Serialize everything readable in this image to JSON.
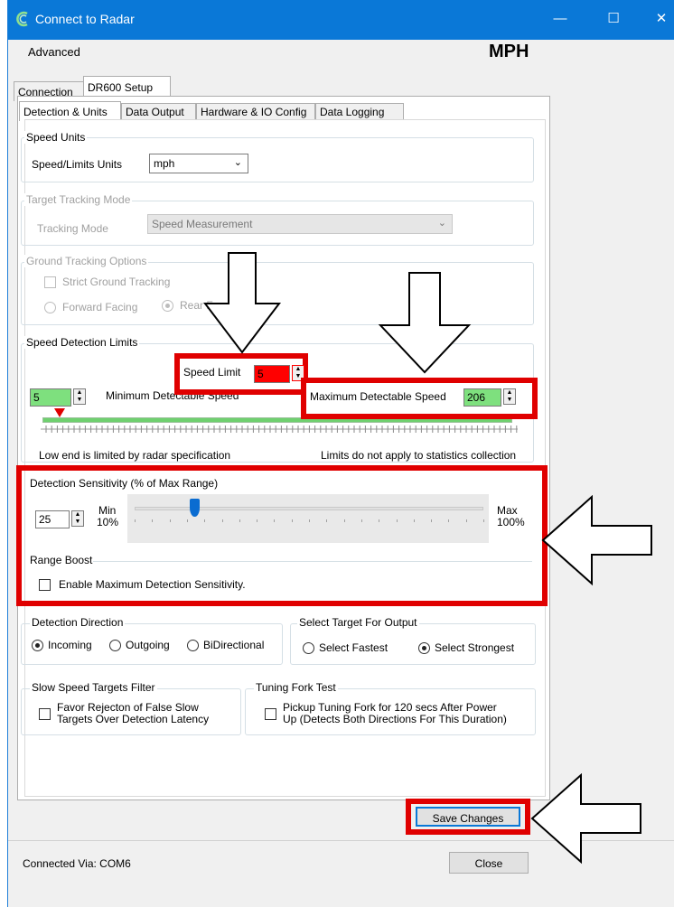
{
  "window": {
    "title": "Connect to Radar",
    "minimize_glyph": "—",
    "maximize_glyph": "☐",
    "close_glyph": "✕"
  },
  "menu": {
    "advanced": "Advanced"
  },
  "units_badge": "MPH",
  "outer_tabs": [
    "Connection",
    "DR600 Setup"
  ],
  "inner_tabs": [
    "Detection & Units",
    "Data Output",
    "Hardware & IO Config",
    "Data Logging"
  ],
  "speed_units": {
    "legend": "Speed Units",
    "label": "Speed/Limits Units",
    "value": "mph"
  },
  "target_tracking": {
    "legend": "Target Tracking Mode",
    "label": "Tracking Mode",
    "value": "Speed Measurement"
  },
  "ground_tracking": {
    "legend": "Ground Tracking Options",
    "strict": "Strict Ground Tracking",
    "forward": "Forward Facing",
    "rear": "Rear F"
  },
  "speed_limits": {
    "legend": "Speed Detection Limits",
    "speed_limit_label": "Speed Limit",
    "speed_limit_value": "5",
    "min_value": "5",
    "min_label": "Minimum Detectable Speed",
    "max_label": "Maximum Detectable Speed",
    "max_value": "206",
    "note_left": "Low end is limited by radar specification",
    "note_right": "Limits do not apply to statistics collection"
  },
  "sensitivity": {
    "legend": "Detection Sensitivity (% of Max Range)",
    "value": "25",
    "min_label": "Min",
    "min_pct": "10%",
    "max_label": "Max",
    "max_pct": "100%",
    "level_fraction": 0.17
  },
  "range_boost": {
    "legend": "Range Boost",
    "checkbox_label": "Enable Maximum Detection Sensitivity."
  },
  "direction": {
    "legend": "Detection Direction",
    "options": [
      "Incoming",
      "Outgoing",
      "BiDirectional"
    ],
    "selected": "Incoming"
  },
  "target_output": {
    "legend": "Select Target For Output",
    "options": [
      "Select Fastest",
      "Select Strongest"
    ],
    "selected": "Select Strongest"
  },
  "slow_filter": {
    "legend": "Slow Speed Targets Filter",
    "label_line1": "Favor Rejecton of False Slow",
    "label_line2": "Targets Over Detection Latency"
  },
  "tuning_fork": {
    "legend": "Tuning Fork Test",
    "label_line1": "Pickup Tuning Fork for 120 secs After Power",
    "label_line2": "Up (Detects Both Directions For This Duration)"
  },
  "save_button": "Save Changes",
  "status": {
    "connected_via": "Connected Via:  COM6"
  },
  "close_button": "Close",
  "colors": {
    "titlebar": "#0a78d7",
    "annotation_red": "#e00000",
    "field_green": "#7ee07e",
    "field_red": "#ff0000"
  }
}
